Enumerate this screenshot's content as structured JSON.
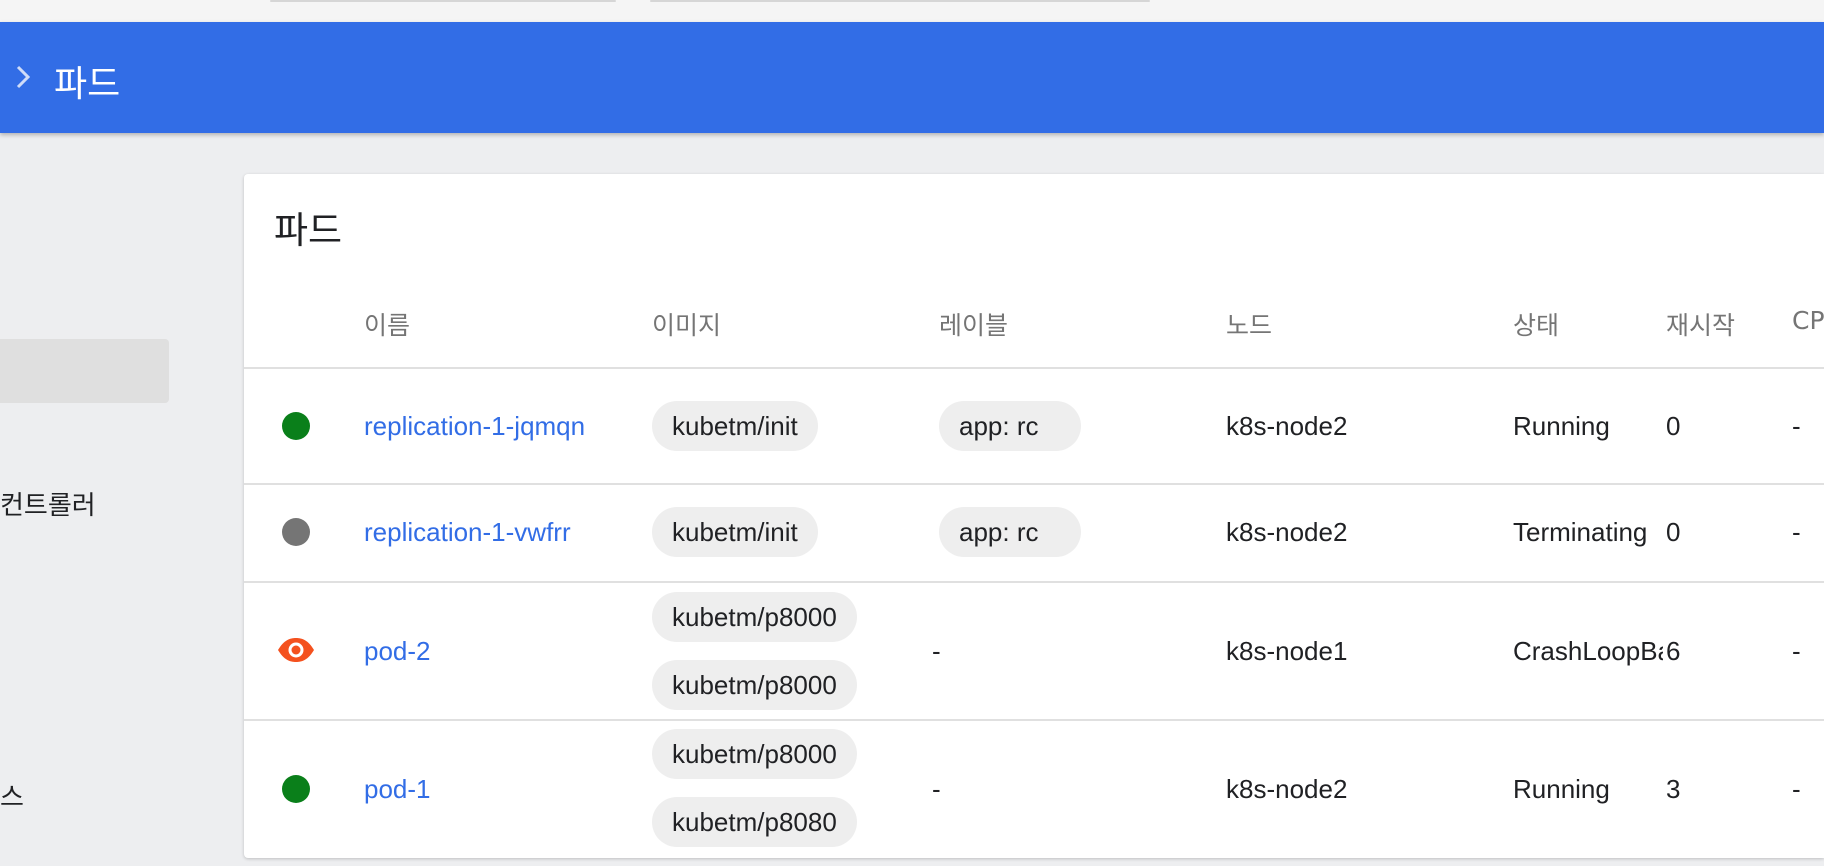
{
  "header": {
    "breadcrumb": "파드"
  },
  "sidebar": {
    "items": [
      "컨트롤러",
      "스"
    ]
  },
  "card": {
    "title": "파드",
    "columns": [
      "이름",
      "이미지",
      "레이블",
      "노드",
      "상태",
      "재시작",
      "CP"
    ]
  },
  "pods": [
    {
      "status_icon": "green-dot-icon",
      "name": "replication-1-jqmqn",
      "images": [
        "kubetm/init"
      ],
      "labels": [
        "app: rc"
      ],
      "node": "k8s-node2",
      "status": "Running",
      "restarts": "0",
      "cpu": "-"
    },
    {
      "status_icon": "grey-dot-icon",
      "name": "replication-1-vwfrr",
      "images": [
        "kubetm/init"
      ],
      "labels": [
        "app: rc"
      ],
      "node": "k8s-node2",
      "status": "Terminating",
      "restarts": "0",
      "cpu": "-"
    },
    {
      "status_icon": "warning-eye-icon",
      "name": "pod-2",
      "images": [
        "kubetm/p8000",
        "kubetm/p8000"
      ],
      "label_text": "-",
      "node": "k8s-node1",
      "status": "CrashLoopBackOff",
      "restarts": "6",
      "cpu": "-"
    },
    {
      "status_icon": "green-dot-icon",
      "name": "pod-1",
      "images": [
        "kubetm/p8000",
        "kubetm/p8080"
      ],
      "label_text": "-",
      "node": "k8s-node2",
      "status": "Running",
      "restarts": "3",
      "cpu": "-"
    }
  ],
  "colors": {
    "header": "#326de6",
    "link": "#326de6",
    "running": "#0a7f1a",
    "terminating": "#757575",
    "error": "#f4511e"
  }
}
